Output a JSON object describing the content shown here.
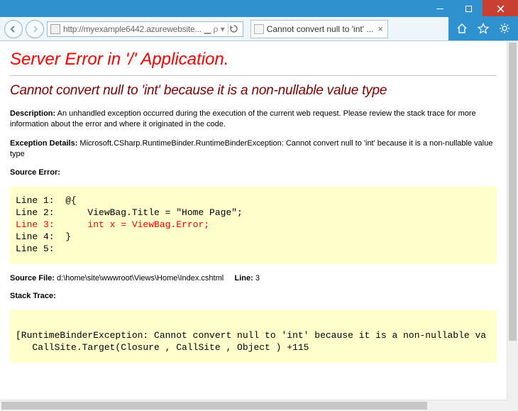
{
  "window": {
    "address_url": "http://myexample6442.azurewebsite...",
    "address_suffix": "▁ρ ▾",
    "tab_title": "Cannot convert null to 'int' ..."
  },
  "error": {
    "h1": "Server Error in '/' Application.",
    "h2": "Cannot convert null to 'int' because it is a non-nullable value type",
    "description_label": "Description:",
    "description_text": "An unhandled exception occurred during the execution of the current web request. Please review the stack trace for more information about the error and where it originated in the code.",
    "exception_label": "Exception Details:",
    "exception_text": "Microsoft.CSharp.RuntimeBinder.RuntimeBinderException: Cannot convert null to 'int' because it is a non-nullable value type",
    "source_error_label": "Source Error:",
    "code_lines": {
      "l1": "Line 1:  @{",
      "l2": "Line 2:      ViewBag.Title = \"Home Page\";",
      "l3": "Line 3:      int x = ViewBag.Error;",
      "l4": "Line 4:  }",
      "l5": "Line 5:"
    },
    "source_file_label": "Source File:",
    "source_file_path": "d:\\home\\site\\wwwroot\\Views\\Home\\Index.cshtml",
    "line_label": "Line:",
    "line_number": "3",
    "stack_trace_label": "Stack Trace:",
    "stack_trace_text": "[RuntimeBinderException: Cannot convert null to 'int' because it is a non-nullable va\n   CallSite.Target(Closure , CallSite , Object ) +115"
  }
}
